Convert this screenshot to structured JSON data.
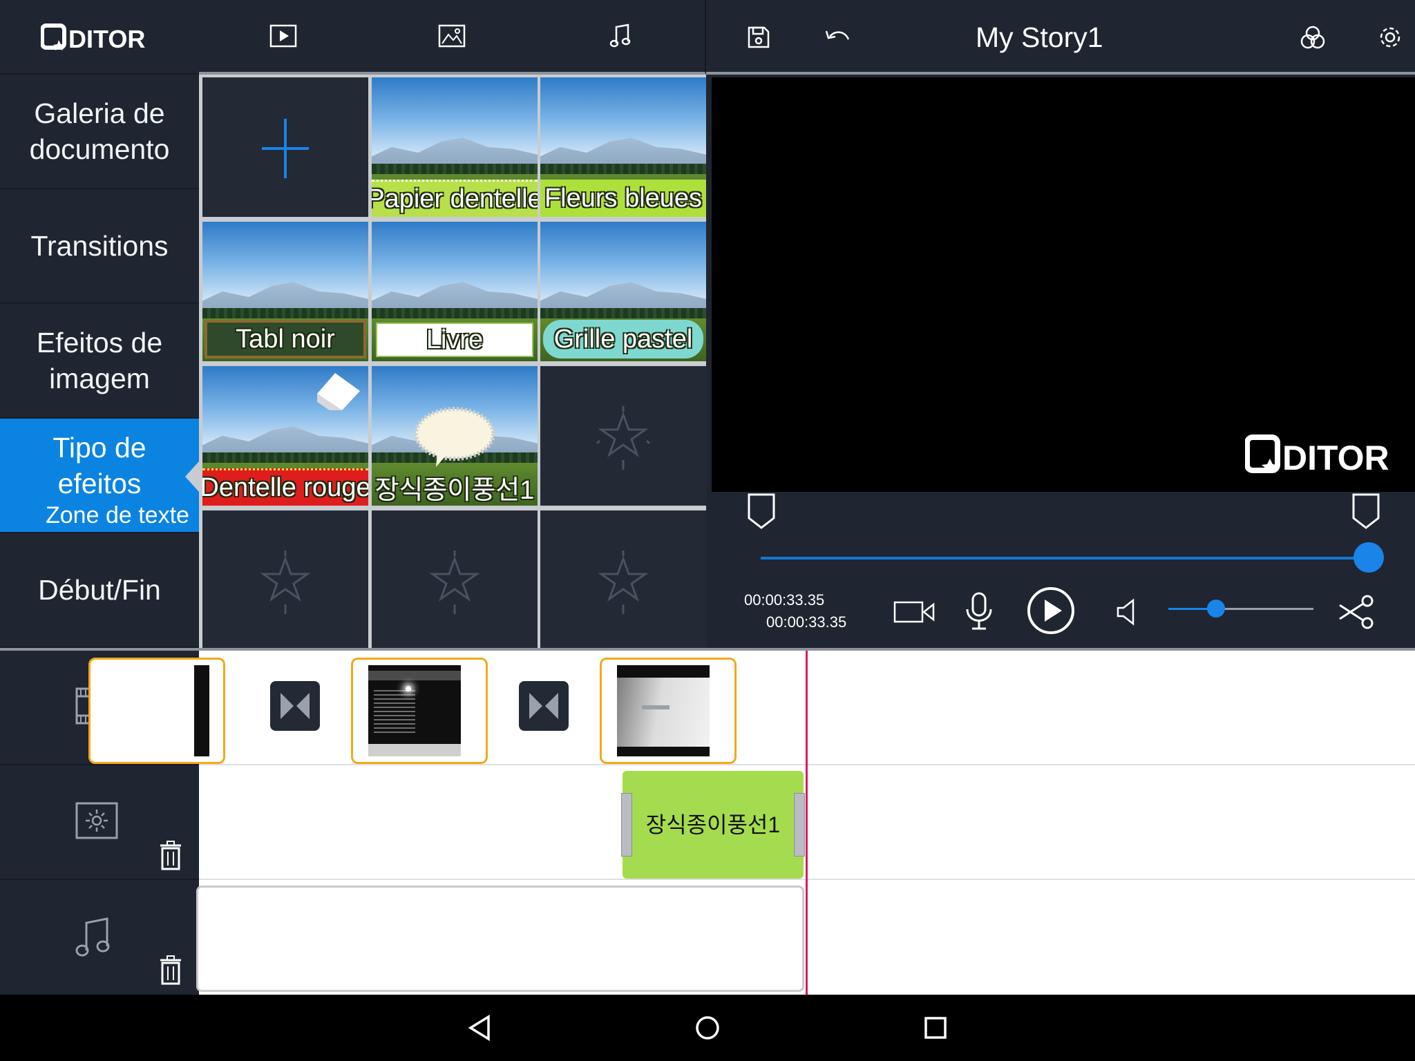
{
  "app": {
    "logo_text": "QDITOR",
    "project_title": "My Story1"
  },
  "toolbar": {
    "icons": [
      "play-video-icon",
      "image-icon",
      "music-icon",
      "save-icon",
      "undo-icon",
      "color-filter-icon",
      "settings-icon"
    ]
  },
  "sidebar": {
    "items": [
      {
        "label": "Galeria de documento"
      },
      {
        "label": "Transitions"
      },
      {
        "label": "Efeitos de imagem"
      },
      {
        "label": "Tipo de efeitos",
        "sublabel": "Zone de texte",
        "active": true
      },
      {
        "label": "Début/Fin"
      }
    ]
  },
  "effects_grid": {
    "tiles": [
      {
        "type": "add"
      },
      {
        "label": "Papier dentelle",
        "banner_color": "#b7e04a"
      },
      {
        "label": "Fleurs bleues",
        "banner_color": "#aee03c"
      },
      {
        "label": "Tabl noir",
        "banner_color": "#2f4a2b"
      },
      {
        "label": "Livre",
        "banner_color": "#ffffff"
      },
      {
        "label": "Grille pastel",
        "banner_color": "#7fd8d0"
      },
      {
        "label": "Dentelle rouge",
        "banner_color": "#e01d1d"
      },
      {
        "label": "장식종이풍선1",
        "banner_color": "#79a83a"
      },
      {
        "type": "empty"
      },
      {
        "type": "empty"
      },
      {
        "type": "empty"
      },
      {
        "type": "empty"
      }
    ]
  },
  "player": {
    "watermark": "QDITOR",
    "position_progress": 1.0,
    "time_current": "00:00:33.35",
    "time_total": "00:00:33.35",
    "volume_level": 0.33
  },
  "timeline": {
    "text_clip_label": "장식종이풍선1"
  },
  "colors": {
    "accent": "#0b84e1",
    "clip_border": "#f2a91b",
    "text_clip": "#a5dc4f",
    "playhead": "#e0195c"
  }
}
